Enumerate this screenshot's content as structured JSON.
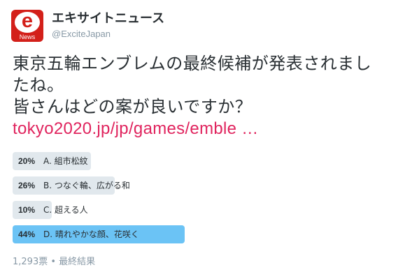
{
  "account": {
    "display_name": "エキサイトニュース",
    "handle": "@ExciteJapan",
    "avatar_letter": "e",
    "avatar_subtext": "News",
    "avatar_color": "#d3201a"
  },
  "tweet": {
    "text_line1": "東京五輪エンブレムの最終候補が発表されまし",
    "text_line2": "たね。",
    "text_line3": "皆さんはどの案が良いですか？",
    "link_text": "tokyo2020.jp/jp/games/emble …",
    "link_color": "#e0245e"
  },
  "poll": {
    "options": [
      {
        "percent": 20,
        "percent_label": "20%",
        "label": "A. 組市松紋",
        "winner": false
      },
      {
        "percent": 26,
        "percent_label": "26%",
        "label": "B. つなぐ輪、広がる和",
        "winner": false
      },
      {
        "percent": 10,
        "percent_label": "10%",
        "label": "C. 超える人",
        "winner": false
      },
      {
        "percent": 44,
        "percent_label": "44%",
        "label": "D. 晴れやかな顔、花咲く",
        "winner": true
      }
    ],
    "footer": "1,293票 • 最終結果",
    "bar_color": "#e1e8ed",
    "winner_color": "#6bc3f5"
  }
}
